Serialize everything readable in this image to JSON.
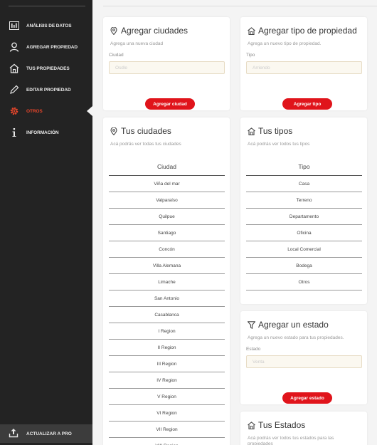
{
  "sidebar": {
    "items": [
      {
        "label": "ANÁLISIS DE DATOS",
        "icon": "analytics-icon"
      },
      {
        "label": "AGREGAR PROPIEDAD",
        "icon": "user-icon"
      },
      {
        "label": "TUS PROPIEDADES",
        "icon": "home-icon"
      },
      {
        "label": "EDITAR PROPIEDAD",
        "icon": "pencil-icon"
      },
      {
        "label": "OTROS",
        "icon": "gear-icon",
        "active": true
      },
      {
        "label": "INFORMACIÓN",
        "icon": "info-icon"
      }
    ],
    "upgrade_label": "ACTUALIZAR A PRO"
  },
  "colors": {
    "accent": "#e0141b",
    "active": "#e8462b",
    "sidebar_bg": "#232323"
  },
  "add_city": {
    "title": "Agregar ciudades",
    "subtitle": "Agrega una nueva ciudad",
    "field_label": "Ciudad",
    "placeholder": "Osdle",
    "button": "Agregar ciudad"
  },
  "add_type": {
    "title": "Agregar tipo de propiedad",
    "subtitle": "Agrega un nuevo tipo de propiedad.",
    "field_label": "Tipo",
    "placeholder": "Arriendo",
    "button": "Agregar tipo"
  },
  "cities": {
    "title": "Tus ciudades",
    "subtitle": "Acá podrás ver todas tus ciudades",
    "column": "Ciudad",
    "rows": [
      "Viña del mar",
      "Valparaíso",
      "Quilpue",
      "Santiago",
      "Concón",
      "Villa Alemana",
      "Limache",
      "San Antonio",
      "Casablanca",
      "I Region",
      "II Region",
      "III Region",
      "IV Region",
      "V Region",
      "VI Region",
      "VII Region",
      "VIII Region"
    ]
  },
  "types": {
    "title": "Tus tipos",
    "subtitle": "Acá podrás ver todos tus tipos",
    "column": "Tipo",
    "rows": [
      "Casa",
      "Terreno",
      "Departamento",
      "Oficina",
      "Local Comercial",
      "Bodega",
      "Otros"
    ]
  },
  "add_state": {
    "title": "Agregar un estado",
    "subtitle": "Agrega un nuevo estado para tus propiedades.",
    "field_label": "Estado",
    "placeholder": "Venta",
    "button": "Agregar estado"
  },
  "states": {
    "title": "Tus Estados",
    "subtitle": "Acá podrás ver todos tus estados para las propiedades"
  }
}
